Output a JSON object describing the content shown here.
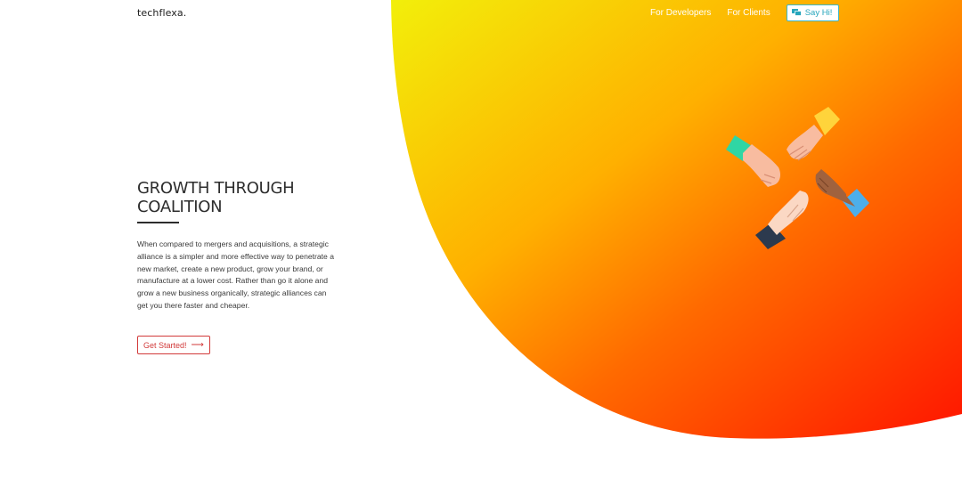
{
  "header": {
    "logo": "techflexa.",
    "nav": {
      "developers": "For Developers",
      "clients": "For Clients",
      "say_hi": "Say Hi!"
    }
  },
  "hero": {
    "title": "GROWTH THROUGH COALITION",
    "body": "When compared to mergers and acquisitions, a strategic alliance is a simpler and more effective way to penetrate a new market, create a new product, grow your brand, or manufacture at a lower cost. Rather than go it alone and grow a new business organically, strategic alliances can get you there faster and cheaper.",
    "cta_label": "Get Started!"
  },
  "icons": {
    "say_hi": "chat-icon",
    "cta": "arrow-right-icon",
    "illustration": "four-hands-icon"
  },
  "colors": {
    "gradient_start": "#f2ef0a",
    "gradient_mid": "#ff8a00",
    "gradient_end": "#ff1400",
    "accent_teal": "#27a6bc",
    "cta_red": "#d23a3a"
  }
}
